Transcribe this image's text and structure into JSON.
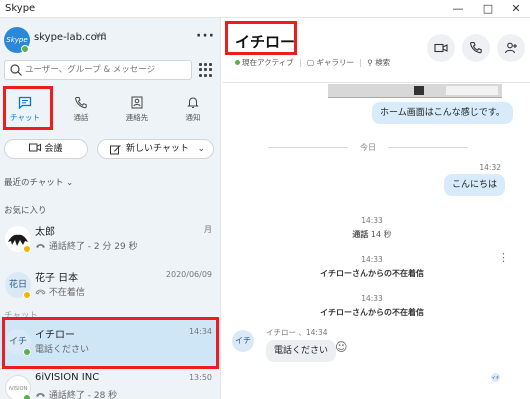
{
  "window": {
    "title": "Skype"
  },
  "account": {
    "name": "skype-lab.com",
    "credit": "¥0",
    "avatar_text": "Skype"
  },
  "search": {
    "placeholder": "ユーザー、グループ & メッセージ"
  },
  "tabs": [
    {
      "label": "チャット",
      "icon": "chat-icon",
      "active": true
    },
    {
      "label": "通話",
      "icon": "phone-icon"
    },
    {
      "label": "連絡先",
      "icon": "contacts-icon"
    },
    {
      "label": "通知",
      "icon": "bell-icon"
    }
  ],
  "buttons": {
    "meet": "会議",
    "new_chat": "新しいチャット"
  },
  "sections": {
    "recent": "最近のチャット",
    "favorites": "お気に入り",
    "chats": "チャット"
  },
  "chat_list": [
    {
      "name": "太郎",
      "time": "月",
      "subtitle": "通話終了 - 2 分 29 秒"
    },
    {
      "name": "花子 日本",
      "time": "2020/06/09",
      "subtitle": "不在着信",
      "avatar": "花日"
    },
    {
      "name": "イチロー",
      "time": "14:34",
      "subtitle": "電話ください",
      "avatar": "イチ",
      "selected": true
    },
    {
      "name": "6iVISION INC",
      "time": "13:50",
      "subtitle": "通話終了 - 28 秒"
    }
  ],
  "conversation": {
    "title": "イチロー",
    "status": "現在アクティブ",
    "gallery": "ギャラリー",
    "search": "検索",
    "messages": {
      "home_screen": "ホーム画面はこんな感じです。",
      "date_sep": "今日",
      "time1": "14:32",
      "hello": "こんにちは",
      "time2": "14:33",
      "call_label": "通話",
      "call_duration": "14 秒",
      "time3": "14:33",
      "missed1": "イチローさんからの不在着信",
      "time4": "14:33",
      "missed2": "イチローさんからの不在着信",
      "sender_line": "イチロー 、14:34",
      "please_call": "電話ください",
      "sender_avatar": "イチ"
    }
  },
  "colors": {
    "accent": "#0078d4",
    "highlight": "#ee1d1d",
    "presence": "#56b148",
    "selected_row": "#cfe6f7"
  }
}
